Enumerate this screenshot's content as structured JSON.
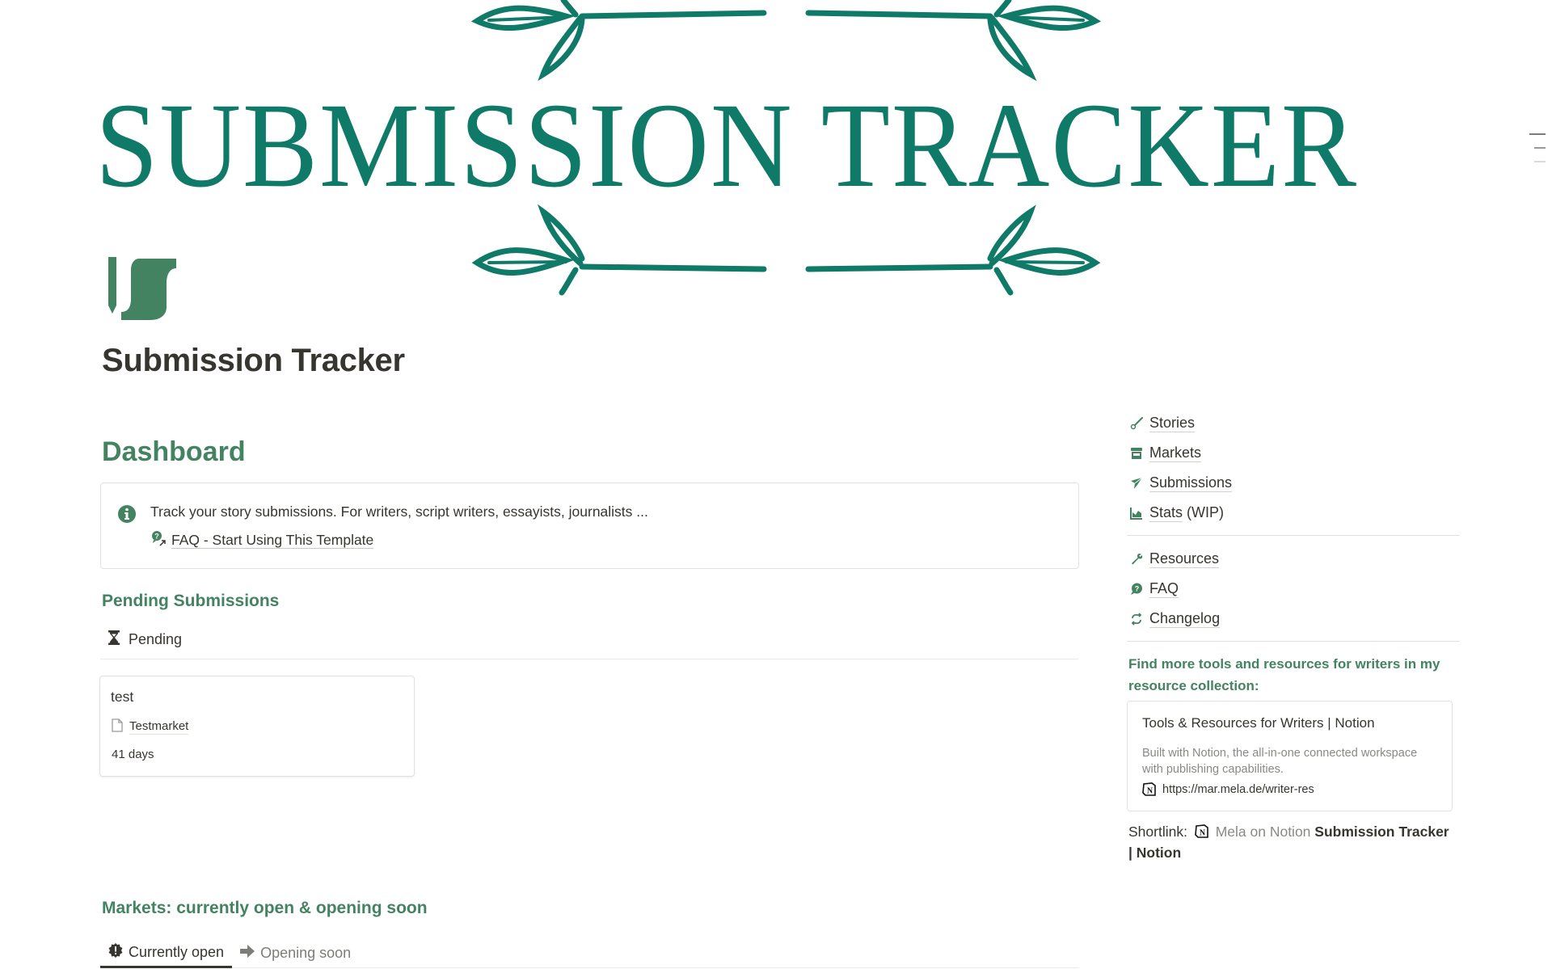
{
  "cover": {
    "title": "SUBMISSION TRACKER",
    "color": "#0f7a67"
  },
  "page": {
    "title": "Submission Tracker",
    "icon": "pen-scroll-logo-icon",
    "accent": "#448361"
  },
  "dashboard": {
    "heading": "Dashboard",
    "callout": {
      "icon": "info-circle-icon",
      "text": "Track your story submissions. For writers, script writers, essayists, journalists ...",
      "link": {
        "icon": "question-link-icon",
        "label": "FAQ - Start Using This Template"
      }
    }
  },
  "pending": {
    "heading": "Pending Submissions",
    "group": {
      "icon": "hourglass-icon",
      "label": "Pending"
    },
    "cards": [
      {
        "title": "test",
        "market": "Testmarket",
        "market_icon": "page-icon",
        "age": "41 days"
      }
    ]
  },
  "markets": {
    "heading": "Markets: currently open & opening soon",
    "tabs": [
      {
        "label": "Currently open",
        "icon": "alert-badge-icon",
        "active": true
      },
      {
        "label": "Opening soon",
        "icon": "arrow-right-icon",
        "active": false
      }
    ]
  },
  "sidebar": {
    "groups": [
      [
        {
          "label": "Stories",
          "icon": "brush-icon"
        },
        {
          "label": "Markets",
          "icon": "store-icon"
        },
        {
          "label": "Submissions",
          "icon": "paper-plane-icon"
        },
        {
          "label": "Stats",
          "suffix": "(WIP)",
          "icon": "area-chart-icon"
        }
      ],
      [
        {
          "label": "Resources",
          "icon": "wrench-icon"
        },
        {
          "label": "FAQ",
          "icon": "question-bubble-icon"
        },
        {
          "label": "Changelog",
          "icon": "refresh-icon"
        }
      ]
    ],
    "promo": "Find more tools and resources for writers in my resource collection:",
    "bookmark": {
      "title": "Tools & Resources for Writers | Notion",
      "description": "Built with Notion, the all-in-one connected workspace with publishing capabilities.",
      "url": "https://mar.mela.de/writer-res"
    },
    "shortlink": {
      "label": "Shortlink:",
      "source": "Mela on Notion",
      "title": "Submission Tracker | Notion"
    }
  }
}
